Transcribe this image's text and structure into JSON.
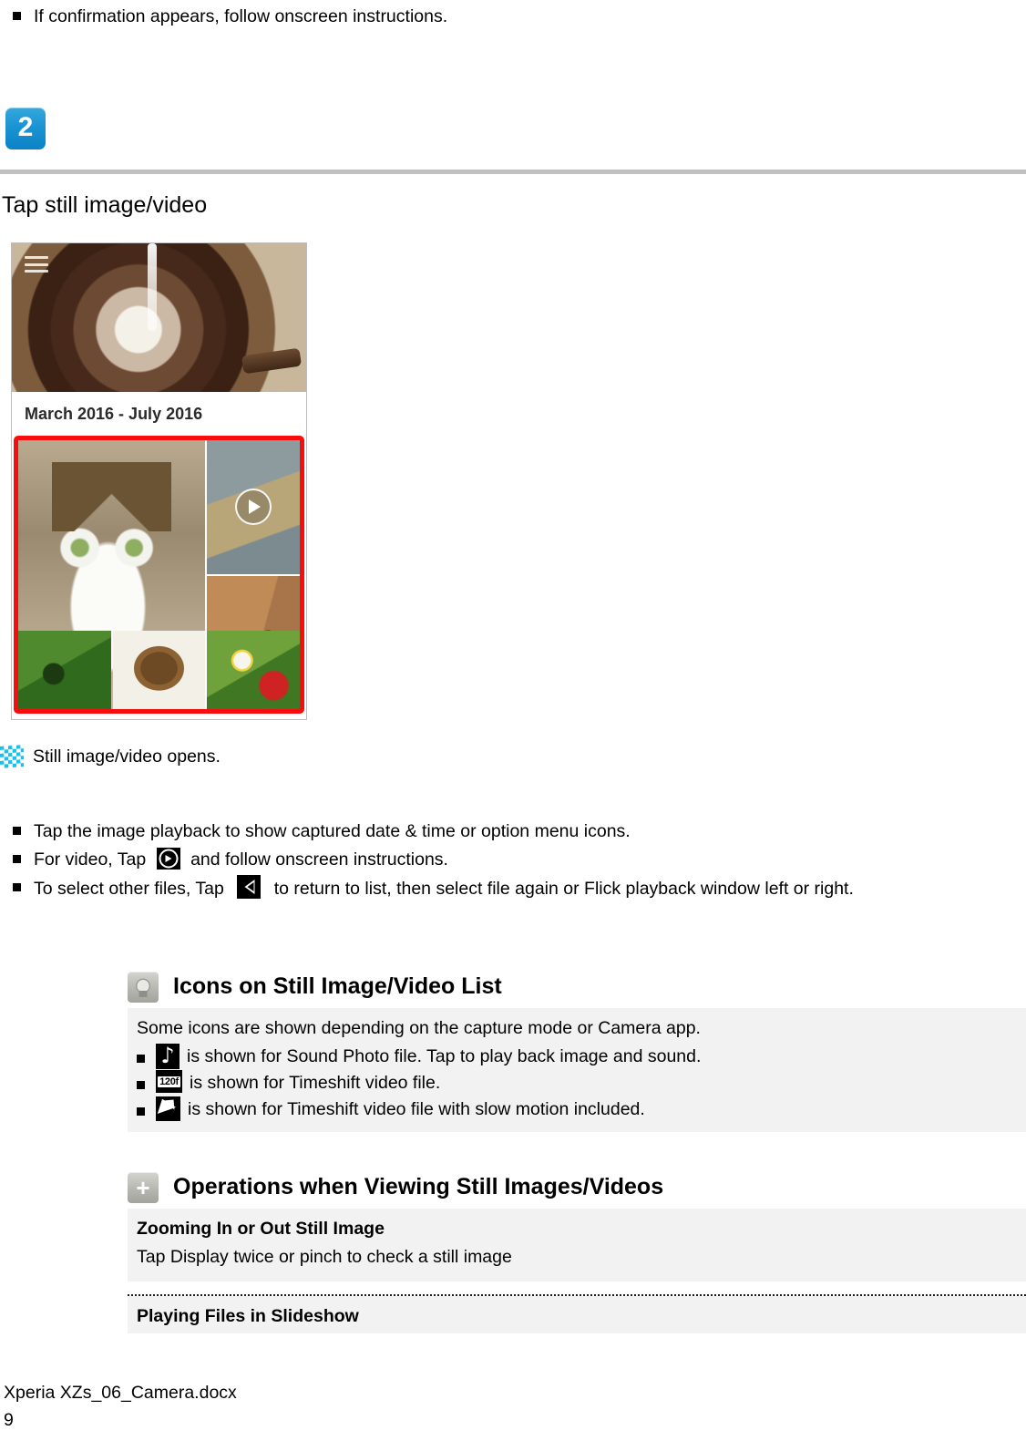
{
  "top_note": {
    "text": "If confirmation appears, follow onscreen instructions."
  },
  "step": {
    "number": "2",
    "heading": "Tap still image/video",
    "badge_color": "#1b94d3"
  },
  "screenshot": {
    "menu_icon": "hamburger-icon",
    "caption": "March 2016 - July 2016",
    "highlight_color": "#f60d0d",
    "tiles": [
      {
        "name": "cat-photo",
        "type": "image"
      },
      {
        "name": "cat-video",
        "type": "video",
        "overlay": "play-icon"
      },
      {
        "name": "wooden-spoons-photo",
        "type": "image"
      },
      {
        "name": "bitter-gourd-photo",
        "type": "image"
      },
      {
        "name": "coffee-cup-photo",
        "type": "image"
      },
      {
        "name": "strawberry-photo",
        "type": "image"
      }
    ]
  },
  "result": {
    "icon": "checkered-flag-icon",
    "text": "Still image/video opens.",
    "icon_color": "#16c1ef"
  },
  "notes": [
    {
      "before": "Tap the image playback to show captured date & time or option menu icons.",
      "icon": null,
      "after": ""
    },
    {
      "before": "For video, Tap",
      "icon": "play-icon",
      "after": "and follow onscreen instructions."
    },
    {
      "before": "To select other files, Tap",
      "icon": "back-arrow-icon",
      "after": "to return to list, then select file again or Flick playback window left or right."
    }
  ],
  "sections": [
    {
      "icon": "lightbulb-icon",
      "title": "Icons on Still Image/Video List",
      "intro": "Some icons are shown depending on the capture mode or Camera app.",
      "items": [
        {
          "icon": "music-note-icon",
          "icon_label": "",
          "text": "is shown for Sound Photo file. Tap to play back image and sound."
        },
        {
          "icon": "timeshift-120f-icon",
          "icon_label": "120f",
          "text": "is shown for Timeshift video file."
        },
        {
          "icon": "slow-motion-bird-icon",
          "icon_label": "",
          "text": "is shown for Timeshift video file with slow motion included."
        }
      ]
    },
    {
      "icon": "plus-icon",
      "title": "Operations when Viewing Still Images/Videos",
      "rows": [
        {
          "subtitle": "Zooming In or Out Still Image",
          "body": "Tap Display twice or pinch to check a still image"
        },
        {
          "subtitle": "Playing Files in Slideshow",
          "body": ""
        }
      ]
    }
  ],
  "footer": {
    "filename": "Xperia XZs_06_Camera.docx",
    "page": "9"
  }
}
